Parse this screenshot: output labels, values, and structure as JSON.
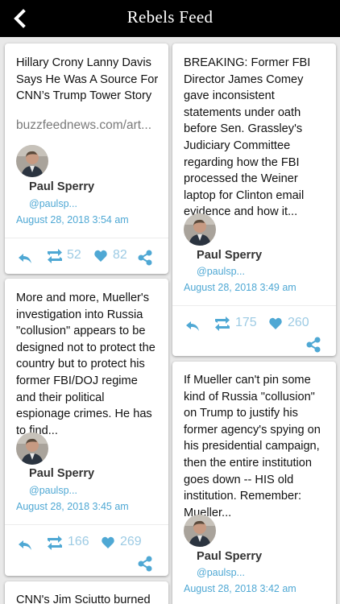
{
  "header": {
    "title": "Rebels Feed"
  },
  "posts": [
    {
      "text": "Hillary Crony Lanny Davis Says He Was A Source For CNN’s Trump Tower Story",
      "link": "buzzfeednews.com/art...",
      "author": "Paul Sperry",
      "handle": "@paulsp...",
      "date": "August 28, 2018 3:54 am",
      "retweets": "52",
      "likes": "82"
    },
    {
      "text": "BREAKING: Former FBI Director James Comey gave inconsistent statements under oath before Sen. Grassley's Judiciary Committee regarding how the FBI processed the Weiner laptop for Clinton email evidence and how it...",
      "author": "Paul Sperry",
      "handle": "@paulsp...",
      "date": "August 28, 2018 3:49 am",
      "retweets": "175",
      "likes": "260"
    },
    {
      "text": "More and more, Mueller's investigation into Russia \"collusion\" appears to be designed not to protect the country but to protect his former FBI/DOJ regime and their political espionage crimes. He has to find...",
      "author": "Paul Sperry",
      "handle": "@paulsp...",
      "date": "August 28, 2018 3:45 am",
      "retweets": "166",
      "likes": "269"
    },
    {
      "text": "If Mueller can't pin some kind of Russia \"collusion\" on Trump to justify his former agency's spying on his presidential campaign, then the entire institution goes down -- HIS old institution. Remember: Mueller...",
      "author": "Paul Sperry",
      "handle": "@paulsp...",
      "date": "August 28, 2018 3:42 am"
    },
    {
      "text": "CNN's Jim Sciutto burned"
    }
  ]
}
